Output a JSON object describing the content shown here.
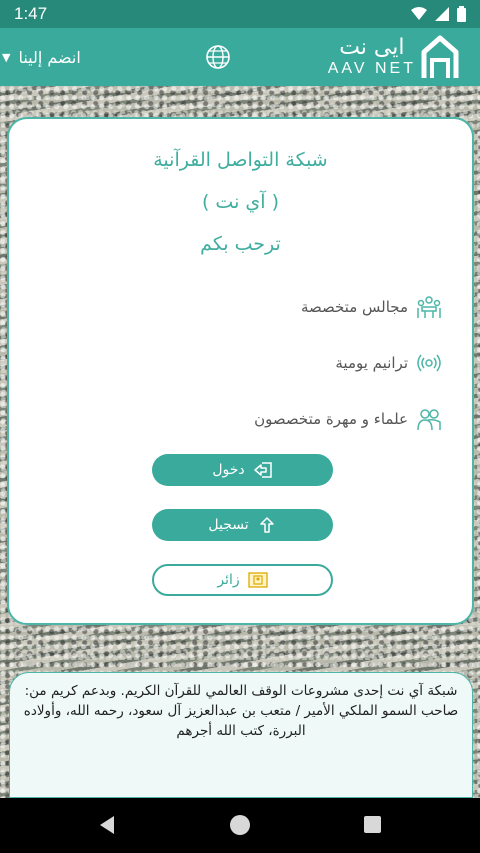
{
  "status_bar": {
    "time": "1:47"
  },
  "app_bar": {
    "join_label": "انضم إلينا",
    "logo_arabic": "ايى نت",
    "logo_english": "AAV NET"
  },
  "card": {
    "welcome_lines": [
      "شبكة التواصل القرآنية",
      "( آي نت )",
      "ترحب بكم"
    ],
    "features": [
      {
        "label": "مجالس متخصصة",
        "icon": "meeting-icon"
      },
      {
        "label": "ترانيم يومية",
        "icon": "audio-icon"
      },
      {
        "label": "علماء و مهرة متخصصون",
        "icon": "scholars-icon"
      }
    ],
    "buttons": {
      "login": "دخول",
      "register": "تسجيل",
      "visitor": "زائر"
    }
  },
  "notice": {
    "line1": "شبكة آي نت إحدى مشروعات الوقف العالمي للقرآن الكريم. وبدعم كريم من:",
    "line2": "صاحب السمو الملكي الأمير / متعب بن عبدالعزيز آل سعود، رحمه الله، وأولاده البررة، كتب الله أجرهم"
  },
  "colors": {
    "primary": "#3aaa9c",
    "status": "#26897a",
    "notice_bg": "#effaf8"
  }
}
